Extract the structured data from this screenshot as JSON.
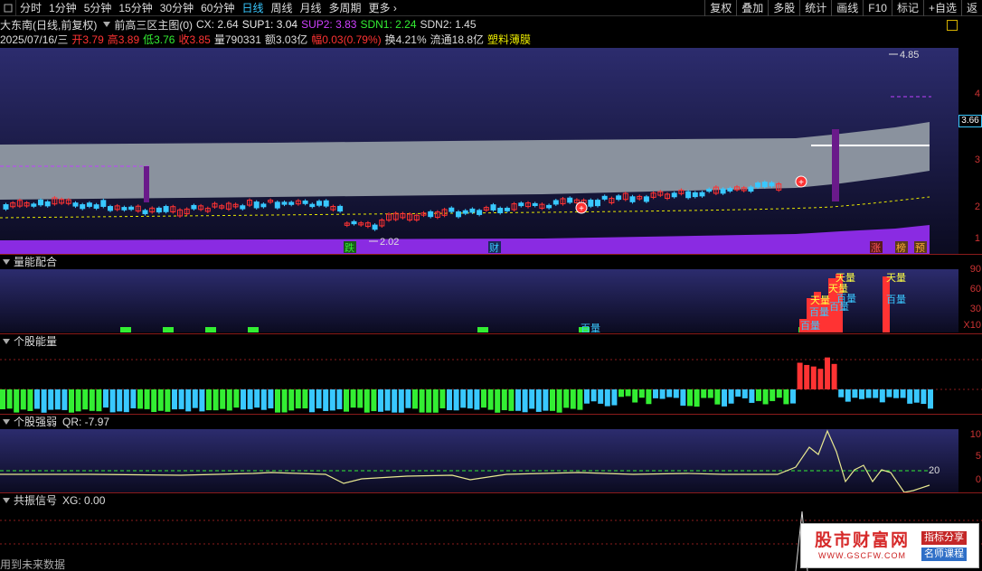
{
  "toolbar": {
    "periods": [
      "分时",
      "1分钟",
      "5分钟",
      "15分钟",
      "30分钟",
      "60分钟",
      "日线",
      "周线",
      "月线",
      "多周期",
      "更多"
    ],
    "active_period": "日线",
    "right_buttons": [
      "复权",
      "叠加",
      "多股",
      "统计",
      "画线",
      "F10",
      "标记",
      "+自选",
      "返"
    ]
  },
  "info_line1": {
    "stock": "大东南(日线,前复权)",
    "indicator": "前高三区主图(0)",
    "cx": "CX: 2.64",
    "sup1": "SUP1: 3.04",
    "sup2": "SUP2: 3.83",
    "sdn1": "SDN1: 2.24",
    "sdn2": "SDN2: 1.45"
  },
  "info_line2": {
    "date": "2025/07/16/三",
    "open": "开3.79",
    "high": "高3.89",
    "low": "低3.76",
    "close": "收3.85",
    "volume": "量790331",
    "amount": "额3.03亿",
    "change": "幅0.03(0.79%)",
    "turnover": "换4.21%",
    "float": "流通18.8亿",
    "sector": "塑料薄膜"
  },
  "main_chart": {
    "price_tag": "3.66",
    "high_label": "4.85",
    "low_label": "2.02",
    "markers": [
      "跌",
      "财",
      "涨",
      "榜",
      "预"
    ],
    "axis_ticks": [
      "4",
      "3",
      "2",
      "1"
    ]
  },
  "panels": {
    "volume": {
      "title": "量能配合",
      "labels": [
        "天量",
        "天量",
        "天量",
        "百量",
        "百量",
        "百量",
        "百量",
        "百量",
        "天量",
        "百量"
      ],
      "axis_ticks": [
        "90",
        "60",
        "30",
        "X10"
      ]
    },
    "energy": {
      "title": "个股能量"
    },
    "strength": {
      "title": "个股强弱",
      "value": "QR: -7.97",
      "ref_label": "20",
      "axis_ticks": [
        "10",
        "5",
        "0"
      ]
    },
    "resonance": {
      "title": "共振信号",
      "value": "XG: 0.00"
    }
  },
  "footer": {
    "text": "用到未来数据"
  },
  "watermark": {
    "title": "股市财富网",
    "url": "WWW.GSCFW.COM",
    "tag1": "指标分享",
    "tag2": "名师课程"
  },
  "colors": {
    "up": "#ff3333",
    "down": "#39c8ff",
    "green": "#33ee33",
    "purple": "#8a2be2",
    "band": "#8a929e"
  }
}
